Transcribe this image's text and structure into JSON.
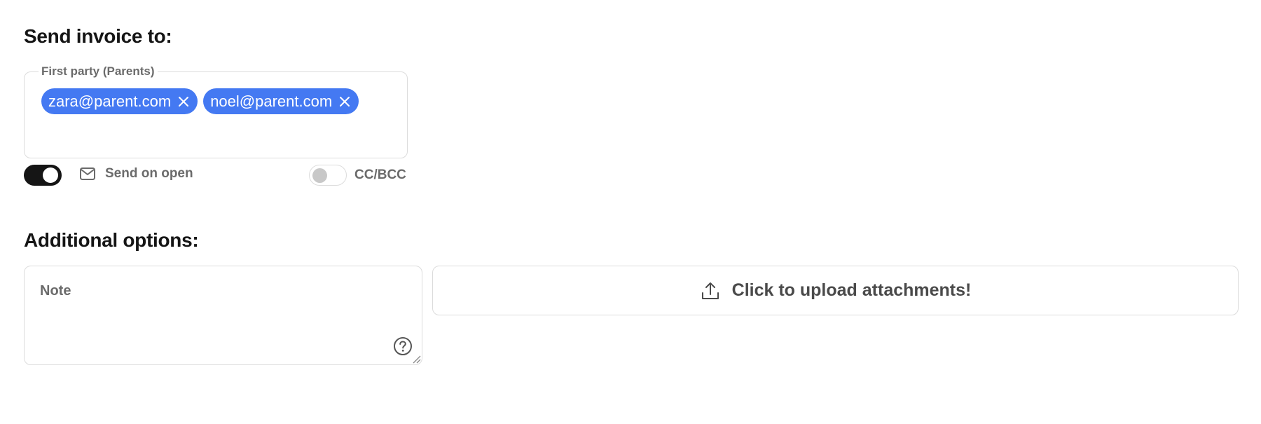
{
  "send_section": {
    "heading": "Send invoice to:",
    "first_party": {
      "legend": "First party (Parents)",
      "recipients": [
        {
          "email": "zara@parent.com"
        },
        {
          "email": "noel@parent.com"
        }
      ]
    },
    "send_on_open": {
      "label": "Send on open",
      "enabled": true,
      "icon": "mail-icon"
    },
    "cc_bcc": {
      "label": "CC/BCC",
      "enabled": false
    }
  },
  "options_section": {
    "heading": "Additional options:",
    "note": {
      "placeholder": "Note",
      "value": ""
    },
    "upload": {
      "label": "Click to upload attachments!",
      "icon": "upload-icon"
    }
  },
  "colors": {
    "chip_background": "#4479f2",
    "toggle_on": "#151515",
    "toggle_off_knob": "#c8c8c8",
    "border": "#dcdcdc",
    "muted_text": "#6b6b6b"
  }
}
